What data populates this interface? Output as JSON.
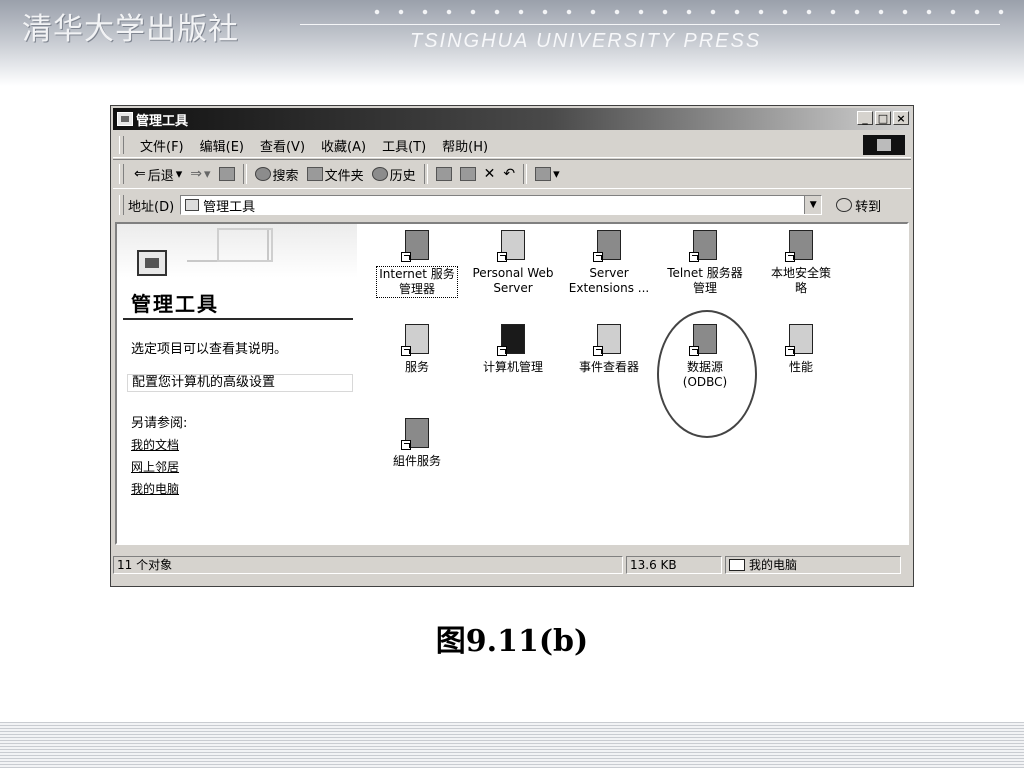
{
  "header": {
    "publisher_cn": "清华大学出版社",
    "publisher_en": "TSINGHUA UNIVERSITY PRESS"
  },
  "caption": "图9.11(b)",
  "window": {
    "title": "管理工具",
    "buttons": {
      "minimize": "_",
      "maximize": "□",
      "close": "×"
    },
    "menu": [
      "文件(F)",
      "编辑(E)",
      "查看(V)",
      "收藏(A)",
      "工具(T)",
      "帮助(H)"
    ],
    "toolbar": {
      "back": "后退",
      "search": "搜索",
      "folders": "文件夹",
      "history": "历史"
    },
    "address": {
      "label": "地址(D)",
      "value": "管理工具",
      "go": "转到"
    },
    "left_pane": {
      "title": "管理工具",
      "hint": "选定项目可以查看其说明。",
      "description": "配置您计算机的高级设置",
      "see_also": "另请参阅:",
      "links": [
        "我的文档",
        "网上邻居",
        "我的电脑"
      ]
    },
    "items": [
      {
        "line1": "Internet 服务",
        "line2": "管理器",
        "icon": "internet-services-icon"
      },
      {
        "line1": "Personal Web",
        "line2": "Server",
        "icon": "personal-web-server-icon"
      },
      {
        "line1": "Server",
        "line2": "Extensions ...",
        "icon": "server-extensions-icon"
      },
      {
        "line1": "Telnet 服务器",
        "line2": "管理",
        "icon": "telnet-server-icon"
      },
      {
        "line1": "本地安全策",
        "line2": "略",
        "icon": "local-security-policy-icon"
      },
      {
        "line1": "服务",
        "line2": "",
        "icon": "services-icon"
      },
      {
        "line1": "计算机管理",
        "line2": "",
        "icon": "computer-management-icon"
      },
      {
        "line1": "事件查看器",
        "line2": "",
        "icon": "event-viewer-icon"
      },
      {
        "line1": "数据源",
        "line2": "(ODBC)",
        "icon": "data-sources-icon"
      },
      {
        "line1": "性能",
        "line2": "",
        "icon": "performance-icon"
      },
      {
        "line1": "組件服务",
        "line2": "",
        "icon": "component-services-icon"
      }
    ],
    "status": {
      "count": "11 个对象",
      "size": "13.6 KB",
      "zone": "我的电脑"
    }
  }
}
